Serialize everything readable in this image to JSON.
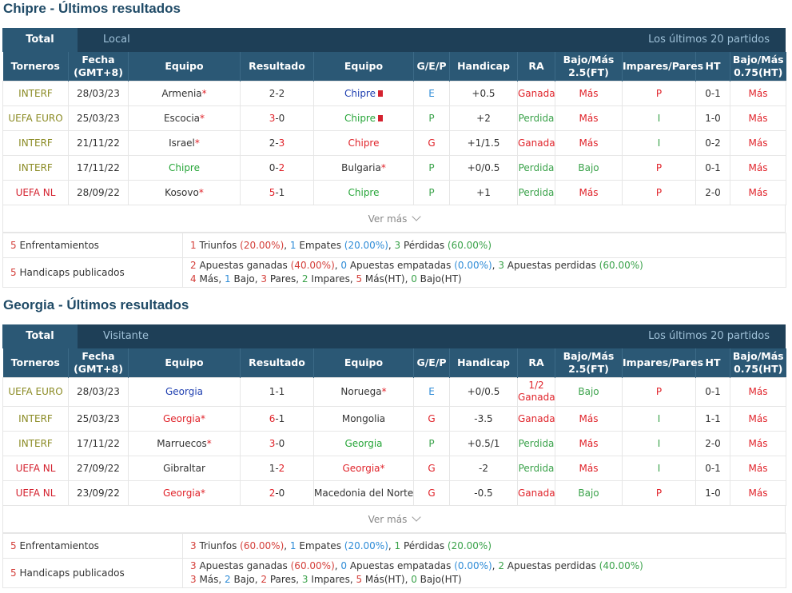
{
  "sections": [
    {
      "title": "Chipre - Últimos resultados",
      "tab_total": "Total",
      "tab_filter": "Local",
      "tab_right": "Los últimos 20 partidos",
      "headers": [
        "Torneros",
        "Fecha (GMT+8)",
        "Equipo",
        "Resultado",
        "Equipo",
        "G/E/P",
        "Handicap",
        "RA",
        "Bajo/Más 2.5(FT)",
        "Impares/Pares",
        "HT",
        "Bajo/Más 0.75(HT)"
      ],
      "rows": [
        {
          "tournament": "INTERF",
          "tournament_color": "olive",
          "date": "28/03/23",
          "home": "Armenia",
          "home_color": "normal",
          "home_star": "*",
          "home_card": false,
          "score_home": "2",
          "score_home_color": "normal",
          "score_sep": "-",
          "score_away": "2",
          "score_away_color": "normal",
          "away": "Chipre",
          "away_color": "blue",
          "away_star": "",
          "away_card": true,
          "gep": "E",
          "gep_color": "blue",
          "handicap": "+0.5",
          "ra": "Ganada",
          "ra_color": "red",
          "ou": "Más",
          "ou_color": "red",
          "oe": "P",
          "oe_color": "red",
          "ht": "0-1",
          "ou_ht": "Más",
          "ou_ht_color": "red"
        },
        {
          "tournament": "UEFA EURO",
          "tournament_color": "olive",
          "date": "25/03/23",
          "home": "Escocia",
          "home_color": "normal",
          "home_star": "*",
          "home_card": false,
          "score_home": "3",
          "score_home_color": "red",
          "score_sep": "-",
          "score_away": "0",
          "score_away_color": "normal",
          "away": "Chipre",
          "away_color": "green",
          "away_star": "",
          "away_card": true,
          "gep": "P",
          "gep_color": "green",
          "handicap": "+2",
          "ra": "Perdida",
          "ra_color": "green",
          "ou": "Más",
          "ou_color": "red",
          "oe": "I",
          "oe_color": "green",
          "ht": "1-0",
          "ou_ht": "Más",
          "ou_ht_color": "red"
        },
        {
          "tournament": "INTERF",
          "tournament_color": "olive",
          "date": "21/11/22",
          "home": "Israel",
          "home_color": "normal",
          "home_star": "*",
          "home_card": false,
          "score_home": "2",
          "score_home_color": "normal",
          "score_sep": "-",
          "score_away": "3",
          "score_away_color": "red",
          "away": "Chipre",
          "away_color": "red",
          "away_star": "",
          "away_card": false,
          "gep": "G",
          "gep_color": "red",
          "handicap": "+1/1.5",
          "ra": "Ganada",
          "ra_color": "red",
          "ou": "Más",
          "ou_color": "red",
          "oe": "I",
          "oe_color": "green",
          "ht": "0-2",
          "ou_ht": "Más",
          "ou_ht_color": "red"
        },
        {
          "tournament": "INTERF",
          "tournament_color": "olive",
          "date": "17/11/22",
          "home": "Chipre",
          "home_color": "green",
          "home_star": "",
          "home_card": false,
          "score_home": "0",
          "score_home_color": "normal",
          "score_sep": "-",
          "score_away": "2",
          "score_away_color": "red",
          "away": "Bulgaria",
          "away_color": "normal",
          "away_star": "*",
          "away_card": false,
          "gep": "P",
          "gep_color": "green",
          "handicap": "+0/0.5",
          "ra": "Perdida",
          "ra_color": "green",
          "ou": "Bajo",
          "ou_color": "green",
          "oe": "P",
          "oe_color": "red",
          "ht": "0-1",
          "ou_ht": "Más",
          "ou_ht_color": "red"
        },
        {
          "tournament": "UEFA NL",
          "tournament_color": "red",
          "date": "28/09/22",
          "home": "Kosovo",
          "home_color": "normal",
          "home_star": "*",
          "home_card": false,
          "score_home": "5",
          "score_home_color": "red",
          "score_sep": "-",
          "score_away": "1",
          "score_away_color": "normal",
          "away": "Chipre",
          "away_color": "green",
          "away_star": "",
          "away_card": false,
          "gep": "P",
          "gep_color": "green",
          "handicap": "+1",
          "ra": "Perdida",
          "ra_color": "green",
          "ou": "Más",
          "ou_color": "red",
          "oe": "P",
          "oe_color": "red",
          "ht": "2-0",
          "ou_ht": "Más",
          "ou_ht_color": "red"
        }
      ],
      "ver_mas": "Ver más",
      "summary": {
        "enf_count": "5",
        "enf_label": "Enfrentamientos",
        "enf_line": [
          {
            "t": "1",
            "c": "n"
          },
          {
            "t": " Triunfos ",
            "c": ""
          },
          {
            "t": "(20.00%)",
            "c": "n"
          },
          {
            "t": ", ",
            "c": ""
          },
          {
            "t": "1",
            "c": "b"
          },
          {
            "t": " Empates ",
            "c": ""
          },
          {
            "t": "(20.00%)",
            "c": "b"
          },
          {
            "t": ", ",
            "c": ""
          },
          {
            "t": "3",
            "c": "g"
          },
          {
            "t": " Pérdidas ",
            "c": ""
          },
          {
            "t": "(60.00%)",
            "c": "g"
          }
        ],
        "hand_count": "5",
        "hand_label": "Handicaps publicados",
        "hand_line1": [
          {
            "t": "2",
            "c": "n"
          },
          {
            "t": " Apuestas ganadas ",
            "c": ""
          },
          {
            "t": "(40.00%)",
            "c": "n"
          },
          {
            "t": ", ",
            "c": ""
          },
          {
            "t": "0",
            "c": "b"
          },
          {
            "t": " Apuestas empatadas ",
            "c": ""
          },
          {
            "t": "(0.00%)",
            "c": "b"
          },
          {
            "t": ", ",
            "c": ""
          },
          {
            "t": "3",
            "c": "g"
          },
          {
            "t": " Apuestas perdidas ",
            "c": ""
          },
          {
            "t": "(60.00%)",
            "c": "g"
          }
        ],
        "hand_line2": [
          {
            "t": "4",
            "c": "n"
          },
          {
            "t": " Más, ",
            "c": ""
          },
          {
            "t": "1",
            "c": "b"
          },
          {
            "t": " Bajo, ",
            "c": ""
          },
          {
            "t": "3",
            "c": "n"
          },
          {
            "t": " Pares, ",
            "c": ""
          },
          {
            "t": "2",
            "c": "g"
          },
          {
            "t": " Impares, ",
            "c": ""
          },
          {
            "t": "5",
            "c": "n"
          },
          {
            "t": " Más(HT), ",
            "c": ""
          },
          {
            "t": "0",
            "c": "g"
          },
          {
            "t": " Bajo(HT)",
            "c": ""
          }
        ]
      }
    },
    {
      "title": "Georgia - Últimos resultados",
      "tab_total": "Total",
      "tab_filter": "Visitante",
      "tab_right": "Los últimos 20 partidos",
      "headers": [
        "Torneros",
        "Fecha (GMT+8)",
        "Equipo",
        "Resultado",
        "Equipo",
        "G/E/P",
        "Handicap",
        "RA",
        "Bajo/Más 2.5(FT)",
        "Impares/Pares",
        "HT",
        "Bajo/Más 0.75(HT)"
      ],
      "rows": [
        {
          "tournament": "UEFA EURO",
          "tournament_color": "olive",
          "date": "28/03/23",
          "home": "Georgia",
          "home_color": "blue",
          "home_star": "",
          "home_card": false,
          "score_home": "1",
          "score_home_color": "normal",
          "score_sep": "-",
          "score_away": "1",
          "score_away_color": "normal",
          "away": "Noruega",
          "away_color": "normal",
          "away_star": "*",
          "away_card": false,
          "gep": "E",
          "gep_color": "blue",
          "handicap": "+0/0.5",
          "ra": "1/2 Ganada",
          "ra_color": "red",
          "ou": "Bajo",
          "ou_color": "green",
          "oe": "P",
          "oe_color": "red",
          "ht": "0-1",
          "ou_ht": "Más",
          "ou_ht_color": "red",
          "tall": true
        },
        {
          "tournament": "INTERF",
          "tournament_color": "olive",
          "date": "25/03/23",
          "home": "Georgia",
          "home_color": "red",
          "home_star": "*",
          "home_card": false,
          "score_home": "6",
          "score_home_color": "red",
          "score_sep": "-",
          "score_away": "1",
          "score_away_color": "normal",
          "away": "Mongolia",
          "away_color": "normal",
          "away_star": "",
          "away_card": false,
          "gep": "G",
          "gep_color": "red",
          "handicap": "-3.5",
          "ra": "Ganada",
          "ra_color": "red",
          "ou": "Más",
          "ou_color": "red",
          "oe": "I",
          "oe_color": "green",
          "ht": "1-1",
          "ou_ht": "Más",
          "ou_ht_color": "red"
        },
        {
          "tournament": "INTERF",
          "tournament_color": "olive",
          "date": "17/11/22",
          "home": "Marruecos",
          "home_color": "normal",
          "home_star": "*",
          "home_card": false,
          "score_home": "3",
          "score_home_color": "red",
          "score_sep": "-",
          "score_away": "0",
          "score_away_color": "normal",
          "away": "Georgia",
          "away_color": "green",
          "away_star": "",
          "away_card": false,
          "gep": "P",
          "gep_color": "green",
          "handicap": "+0.5/1",
          "ra": "Perdida",
          "ra_color": "green",
          "ou": "Más",
          "ou_color": "red",
          "oe": "I",
          "oe_color": "green",
          "ht": "2-0",
          "ou_ht": "Más",
          "ou_ht_color": "red"
        },
        {
          "tournament": "UEFA NL",
          "tournament_color": "red",
          "date": "27/09/22",
          "home": "Gibraltar",
          "home_color": "normal",
          "home_star": "",
          "home_card": false,
          "score_home": "1",
          "score_home_color": "normal",
          "score_sep": "-",
          "score_away": "2",
          "score_away_color": "red",
          "away": "Georgia",
          "away_color": "red",
          "away_star": "*",
          "away_card": false,
          "gep": "G",
          "gep_color": "red",
          "handicap": "-2",
          "ra": "Perdida",
          "ra_color": "green",
          "ou": "Más",
          "ou_color": "red",
          "oe": "I",
          "oe_color": "green",
          "ht": "0-1",
          "ou_ht": "Más",
          "ou_ht_color": "red"
        },
        {
          "tournament": "UEFA NL",
          "tournament_color": "red",
          "date": "23/09/22",
          "home": "Georgia",
          "home_color": "red",
          "home_star": "*",
          "home_card": false,
          "score_home": "2",
          "score_home_color": "red",
          "score_sep": "-",
          "score_away": "0",
          "score_away_color": "normal",
          "away": "Macedonia del Norte",
          "away_color": "normal",
          "away_star": "",
          "away_card": false,
          "gep": "G",
          "gep_color": "red",
          "handicap": "-0.5",
          "ra": "Ganada",
          "ra_color": "red",
          "ou": "Bajo",
          "ou_color": "green",
          "oe": "P",
          "oe_color": "red",
          "ht": "1-0",
          "ou_ht": "Más",
          "ou_ht_color": "red"
        }
      ],
      "ver_mas": "Ver más",
      "summary": {
        "enf_count": "5",
        "enf_label": "Enfrentamientos",
        "enf_line": [
          {
            "t": "3",
            "c": "n"
          },
          {
            "t": " Triunfos ",
            "c": ""
          },
          {
            "t": "(60.00%)",
            "c": "n"
          },
          {
            "t": ", ",
            "c": ""
          },
          {
            "t": "1",
            "c": "b"
          },
          {
            "t": " Empates ",
            "c": ""
          },
          {
            "t": "(20.00%)",
            "c": "b"
          },
          {
            "t": ", ",
            "c": ""
          },
          {
            "t": "1",
            "c": "g"
          },
          {
            "t": " Pérdidas ",
            "c": ""
          },
          {
            "t": "(20.00%)",
            "c": "g"
          }
        ],
        "hand_count": "5",
        "hand_label": "Handicaps publicados",
        "hand_line1": [
          {
            "t": "3",
            "c": "n"
          },
          {
            "t": " Apuestas ganadas ",
            "c": ""
          },
          {
            "t": "(60.00%)",
            "c": "n"
          },
          {
            "t": ", ",
            "c": ""
          },
          {
            "t": "0",
            "c": "b"
          },
          {
            "t": " Apuestas empatadas ",
            "c": ""
          },
          {
            "t": "(0.00%)",
            "c": "b"
          },
          {
            "t": ", ",
            "c": ""
          },
          {
            "t": "2",
            "c": "g"
          },
          {
            "t": " Apuestas perdidas ",
            "c": ""
          },
          {
            "t": "(40.00%)",
            "c": "g"
          }
        ],
        "hand_line2": [
          {
            "t": "3",
            "c": "n"
          },
          {
            "t": " Más, ",
            "c": ""
          },
          {
            "t": "2",
            "c": "b"
          },
          {
            "t": " Bajo, ",
            "c": ""
          },
          {
            "t": "2",
            "c": "n"
          },
          {
            "t": " Pares, ",
            "c": ""
          },
          {
            "t": "3",
            "c": "g"
          },
          {
            "t": " Impares, ",
            "c": ""
          },
          {
            "t": "5",
            "c": "n"
          },
          {
            "t": " Más(HT), ",
            "c": ""
          },
          {
            "t": "0",
            "c": "g"
          },
          {
            "t": " Bajo(HT)",
            "c": ""
          }
        ]
      }
    }
  ],
  "colors": {
    "header_bg": "#2b5875",
    "tabbar_bg": "#1e3f57",
    "title": "#1f4a66",
    "red": "#e0242b",
    "green": "#3aa24a",
    "blue": "#2f8cd7",
    "olive": "#8b8b24"
  }
}
